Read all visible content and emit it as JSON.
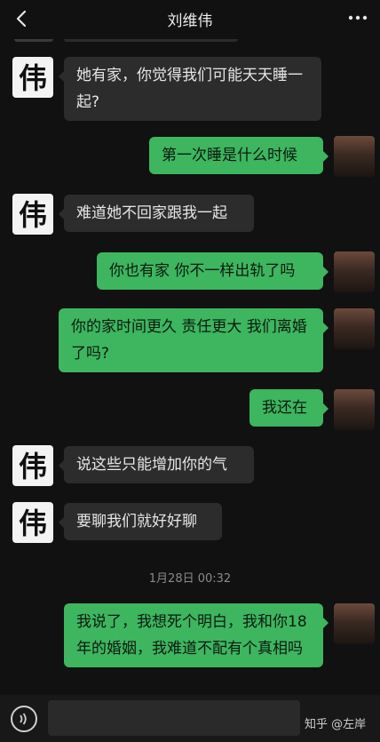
{
  "header": {
    "title": "刘维伟"
  },
  "icons": {
    "back": "chevron-left-icon",
    "more": "more-dots-icon",
    "voice": "voice-icon",
    "avatar_char": "伟"
  },
  "messages": [
    {
      "side": "in",
      "text": "她有家，你觉得我们可能天天睡一起?"
    },
    {
      "side": "out",
      "text": "第一次睡是什么时候"
    },
    {
      "side": "in",
      "text": "难道她不回家跟我一起"
    },
    {
      "side": "out",
      "text": "你也有家 你不一样出轨了吗"
    },
    {
      "side": "out",
      "text": "你的家时间更久 责任更大 我们离婚了吗?"
    },
    {
      "side": "out",
      "text": "我还在"
    },
    {
      "side": "in",
      "text": "说这些只能增加你的气"
    },
    {
      "side": "in",
      "text": "要聊我们就好好聊"
    },
    {
      "side": "out",
      "text": "我说了，我想死个明白，我和你18年的婚姻，我难道不配有个真相吗"
    }
  ],
  "timestamp": "1月28日 00:32",
  "watermark": "知乎 @左岸",
  "colors": {
    "background": "#111111",
    "bubble_in": "#2c2c2c",
    "bubble_out": "#3eb55f"
  }
}
